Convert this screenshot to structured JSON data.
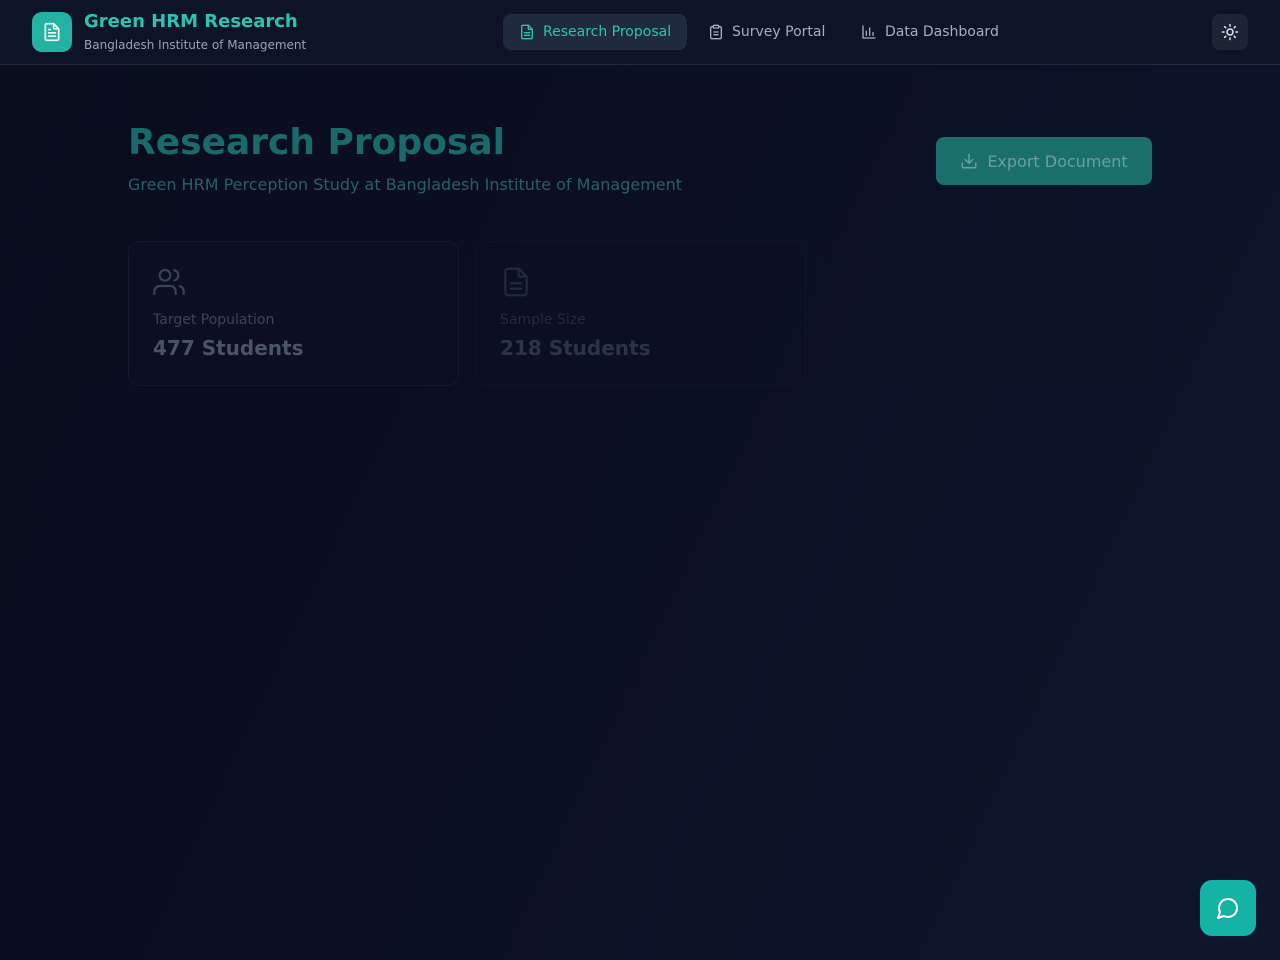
{
  "brand": {
    "title": "Green HRM Research",
    "subtitle": "Bangladesh Institute of Management",
    "logo_icon": "document-icon"
  },
  "nav": {
    "items": [
      {
        "label": "Research Proposal",
        "icon": "document-icon",
        "active": true
      },
      {
        "label": "Survey Portal",
        "icon": "clipboard-icon",
        "active": false
      },
      {
        "label": "Data Dashboard",
        "icon": "bar-chart-icon",
        "active": false
      }
    ]
  },
  "theme_toggle": {
    "icon": "sun-icon"
  },
  "main": {
    "title": "Research Proposal",
    "subtitle": "Green HRM Perception Study at Bangladesh Institute of Management",
    "export_button": {
      "label": "Export Document",
      "icon": "download-icon"
    },
    "stats": [
      {
        "label": "Target Population",
        "value": "477 Students",
        "icon": "users-icon"
      },
      {
        "label": "Sample Size",
        "value": "218 Students",
        "icon": "document-icon"
      }
    ]
  },
  "chat_button": {
    "icon": "message-circle-icon"
  },
  "colors": {
    "accent": "#2dc3b2",
    "accent_button": "#14b3a5",
    "header_bg": "#0e1427",
    "page_bg": "#0a0f22"
  }
}
